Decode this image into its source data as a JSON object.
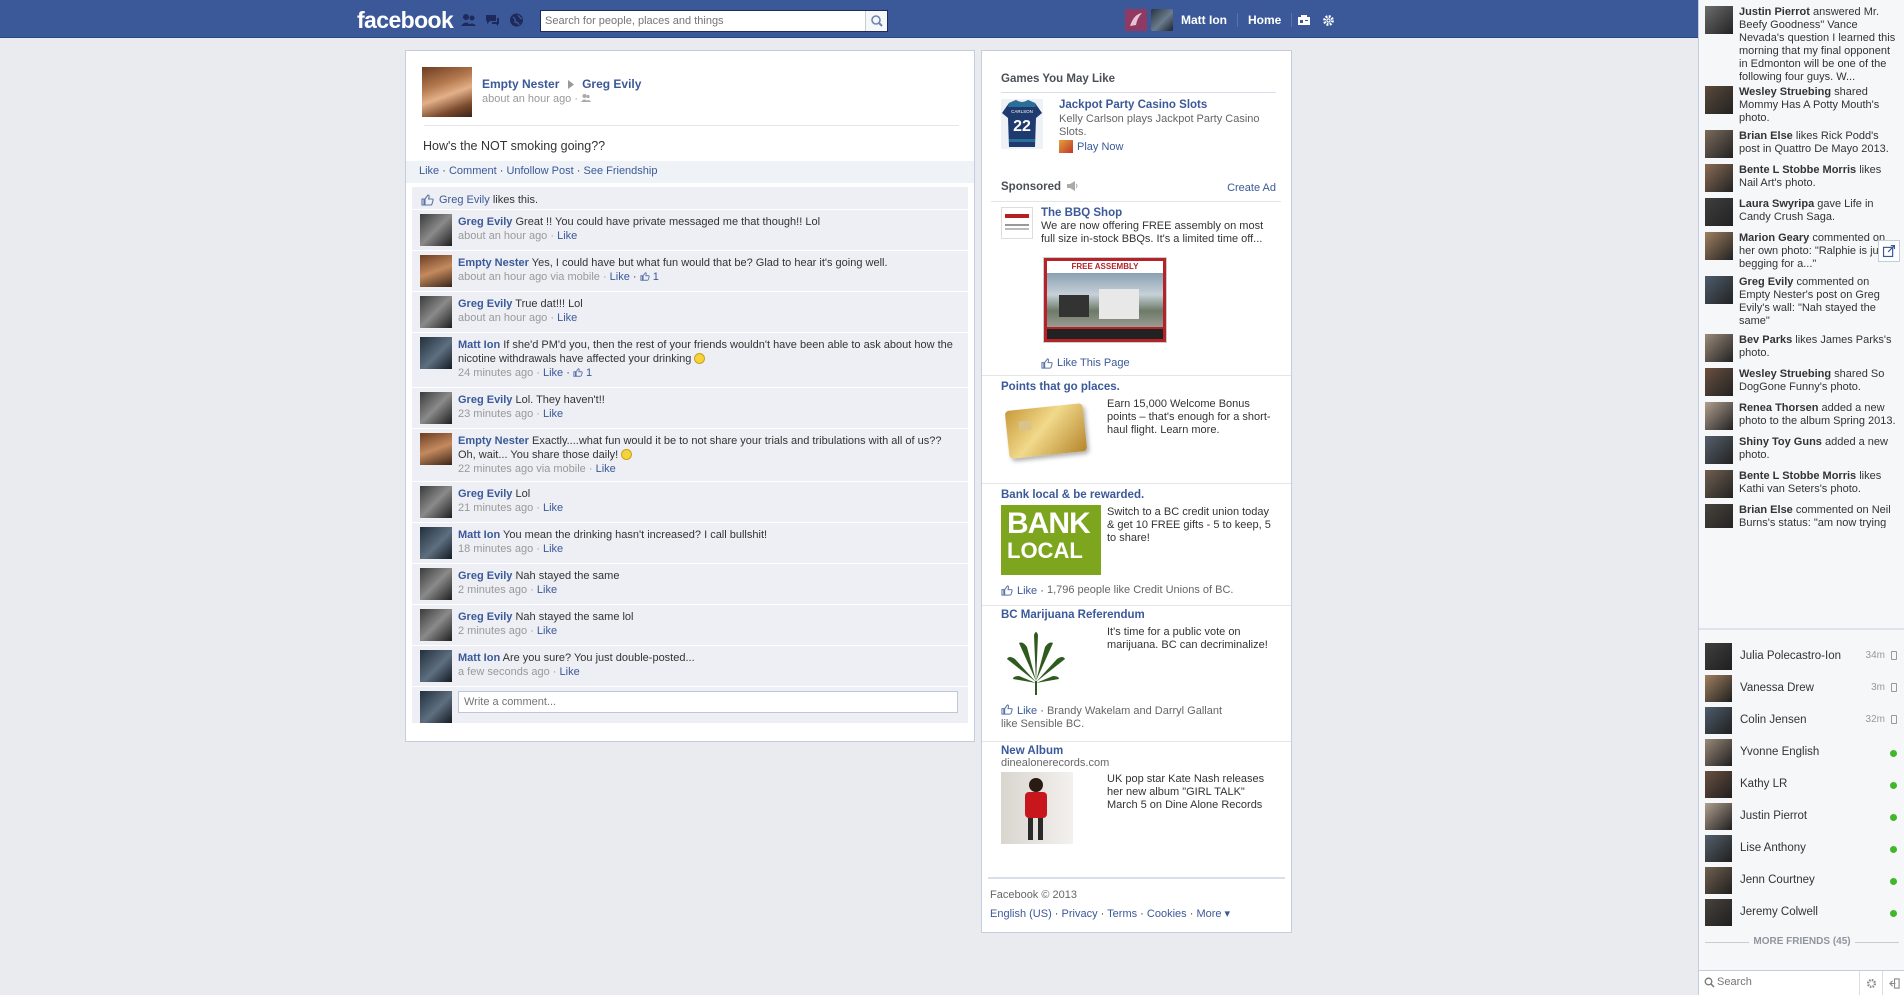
{
  "topbar": {
    "logo": "facebook",
    "search_placeholder": "Search for people, places and things",
    "user_name": "Matt Ion",
    "home": "Home"
  },
  "story": {
    "author": "Empty Nester",
    "target": "Greg Evily",
    "time": "about an hour ago",
    "dot": "·",
    "message": "How's the NOT smoking going??",
    "actions": [
      "Like",
      "Comment",
      "Unfollow Post",
      "See Friendship"
    ],
    "likes_name": "Greg Evily",
    "likes_text": "likes this.",
    "comments": [
      {
        "name": "Greg Evily",
        "text": "Great !! You could have private messaged me that though!! Lol",
        "time": "about an hour ago",
        "like": "Like",
        "likes": ""
      },
      {
        "name": "Empty Nester",
        "text": "Yes, I could have but what fun would that be? Glad to hear it's going well.",
        "time": "about an hour ago via mobile",
        "like": "Like",
        "likes": "1"
      },
      {
        "name": "Greg Evily",
        "text": "True dat!!! Lol",
        "time": "about an hour ago",
        "like": "Like",
        "likes": ""
      },
      {
        "name": "Matt Ion",
        "text": "If she'd PM'd you, then the rest of your friends wouldn't have been able to ask about how the nicotine withdrawals have affected your drinking",
        "time": "24 minutes ago",
        "like": "Like",
        "likes": "1"
      },
      {
        "name": "Greg Evily",
        "text": "Lol. They haven't!!",
        "time": "23 minutes ago",
        "like": "Like",
        "likes": ""
      },
      {
        "name": "Empty Nester",
        "text": "Exactly....what fun would it be to not share your trials and tribulations with all of us?? Oh, wait... You share those daily!",
        "time": "22 minutes ago via mobile",
        "like": "Like",
        "likes": ""
      },
      {
        "name": "Greg Evily",
        "text": "Lol",
        "time": "21 minutes ago",
        "like": "Like",
        "likes": ""
      },
      {
        "name": "Matt Ion",
        "text": "You mean the drinking hasn't increased? I call bullshit!",
        "time": "18 minutes ago",
        "like": "Like",
        "likes": ""
      },
      {
        "name": "Greg Evily",
        "text": "Nah stayed the same",
        "time": "2 minutes ago",
        "like": "Like",
        "likes": ""
      },
      {
        "name": "Greg Evily",
        "text": "Nah stayed the same lol",
        "time": "2 minutes ago",
        "like": "Like",
        "likes": ""
      },
      {
        "name": "Matt Ion",
        "text": "Are you sure? You just double-posted...",
        "time": "a few seconds ago",
        "like": "Like",
        "likes": ""
      }
    ],
    "comment_placeholder": "Write a comment..."
  },
  "right": {
    "games_title": "Games You May Like",
    "game": {
      "title": "Jackpot Party Casino Slots",
      "desc": "Kelly Carlson plays Jackpot Party Casino Slots.",
      "play": "Play Now",
      "jersey_name": "CARLSON",
      "jersey_number": "22"
    },
    "sponsored": "Sponsored",
    "create_ad": "Create Ad",
    "ads": [
      {
        "title": "The BBQ Shop",
        "text": "We are now offering FREE assembly on most full size in-stock BBQs. It's a limited time off...",
        "image_caption": "FREE ASSEMBLY",
        "like": "Like This Page"
      },
      {
        "title": "Points that go places.",
        "text": "Earn 15,000 Welcome Bonus points – that's enough for a short-haul flight. Learn more."
      },
      {
        "title": "Bank local & be rewarded.",
        "text": "Switch to a BC credit union today & get 10 FREE gifts - 5 to keep, 5 to share!",
        "image_line1": "BANK",
        "image_line2": "LOCAL",
        "like": "Like",
        "social": "1,796 people like Credit Unions of BC."
      },
      {
        "title": "BC Marijuana Referendum",
        "text": "It's time for a public vote on marijuana. BC can decriminalize!",
        "like": "Like",
        "social": "Brandy Wakelam and Darryl Gallant like Sensible BC."
      },
      {
        "title": "New Album",
        "domain": "dinealonerecords.com",
        "text": "UK pop star Kate Nash releases her new album \"GIRL TALK\" March 5 on Dine Alone Records"
      }
    ],
    "footer_copy": "Facebook © 2013",
    "footer_links": [
      "English (US)",
      "Privacy",
      "Terms",
      "Cookies",
      "More ▾"
    ]
  },
  "ticker": [
    {
      "name": "Justin Pierrot",
      "text": "answered Mr. Beefy Goodness\" Vance Nevada's question I learned this morning that my final opponent in Edmonton will be one of the following four guys. W..."
    },
    {
      "name": "Wesley Struebing",
      "text": "shared Mommy Has A Potty Mouth's photo."
    },
    {
      "name": "Brian Else",
      "text": "likes Rick Podd's post in Quattro De Mayo 2013."
    },
    {
      "name": "Bente L Stobbe Morris",
      "text": "likes Nail Art's photo."
    },
    {
      "name": "Laura Swyripa",
      "text": "gave Life in Candy Crush Saga."
    },
    {
      "name": "Marion Geary",
      "text": "commented on her own photo: \"Ralphie is just begging for a...\""
    },
    {
      "name": "Greg Evily",
      "text": "commented on Empty Nester's post on Greg Evily's wall: \"Nah stayed the same\""
    },
    {
      "name": "Bev Parks",
      "text": "likes James Parks's photo."
    },
    {
      "name": "Wesley Struebing",
      "text": "shared So DogGone Funny's photo."
    },
    {
      "name": "Renea Thorsen",
      "text": "added a new photo to the album Spring 2013."
    },
    {
      "name": "Shiny Toy Guns",
      "text": "added a new photo."
    },
    {
      "name": "Bente L Stobbe Morris",
      "text": "likes Kathi van Seters's photo."
    },
    {
      "name": "Brian Else",
      "text": "commented on Neil Burns's status: \"am now trying"
    }
  ],
  "friends": [
    {
      "name": "Julia Polecastro-Ion",
      "time": "34m",
      "status": "mobile"
    },
    {
      "name": "Vanessa Drew",
      "time": "3m",
      "status": "mobile"
    },
    {
      "name": "Colin Jensen",
      "time": "32m",
      "status": "mobile"
    },
    {
      "name": "Yvonne English",
      "time": "",
      "status": "online"
    },
    {
      "name": "Kathy LR",
      "time": "",
      "status": "online"
    },
    {
      "name": "Justin Pierrot",
      "time": "",
      "status": "online"
    },
    {
      "name": "Lise Anthony",
      "time": "",
      "status": "online"
    },
    {
      "name": "Jenn Courtney",
      "time": "",
      "status": "online"
    },
    {
      "name": "Jeremy Colwell",
      "time": "",
      "status": "online"
    }
  ],
  "more_friends": "MORE FRIENDS (45)",
  "chat_search_placeholder": "Search",
  "colors": {
    "brand": "#3b5998",
    "link": "#3b5998",
    "ufi_bg": "#edeff4",
    "online": "#42b72a"
  }
}
